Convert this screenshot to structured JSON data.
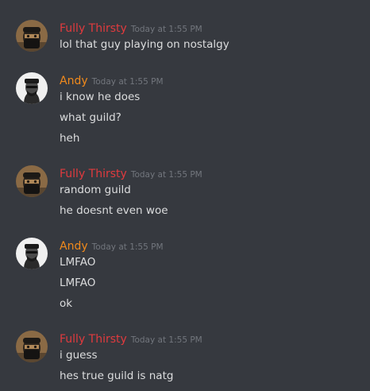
{
  "colors": {
    "background": "#36393f",
    "text": "#dcddde",
    "timestamp": "#72767d",
    "fully_thirsty_name": "#e03a3e",
    "andy_name": "#f18a1c"
  },
  "messages": [
    {
      "author": "Fully Thirsty",
      "avatar_icon": "masked-man-avatar-icon",
      "timestamp": "Today at 1:55 PM",
      "lines": [
        "lol that guy playing on nostalgy"
      ]
    },
    {
      "author": "Andy",
      "avatar_icon": "snoop-dogg-avatar-icon",
      "timestamp": "Today at 1:55 PM",
      "lines": [
        "i know he does",
        "what guild?",
        "heh"
      ]
    },
    {
      "author": "Fully Thirsty",
      "avatar_icon": "masked-man-avatar-icon",
      "timestamp": "Today at 1:55 PM",
      "lines": [
        "random guild",
        "he doesnt even woe"
      ]
    },
    {
      "author": "Andy",
      "avatar_icon": "snoop-dogg-avatar-icon",
      "timestamp": "Today at 1:55 PM",
      "lines": [
        "LMFAO",
        "LMFAO",
        "ok"
      ]
    },
    {
      "author": "Fully Thirsty",
      "avatar_icon": "masked-man-avatar-icon",
      "timestamp": "Today at 1:55 PM",
      "lines": [
        "i guess",
        "hes true guild is natg"
      ]
    }
  ]
}
